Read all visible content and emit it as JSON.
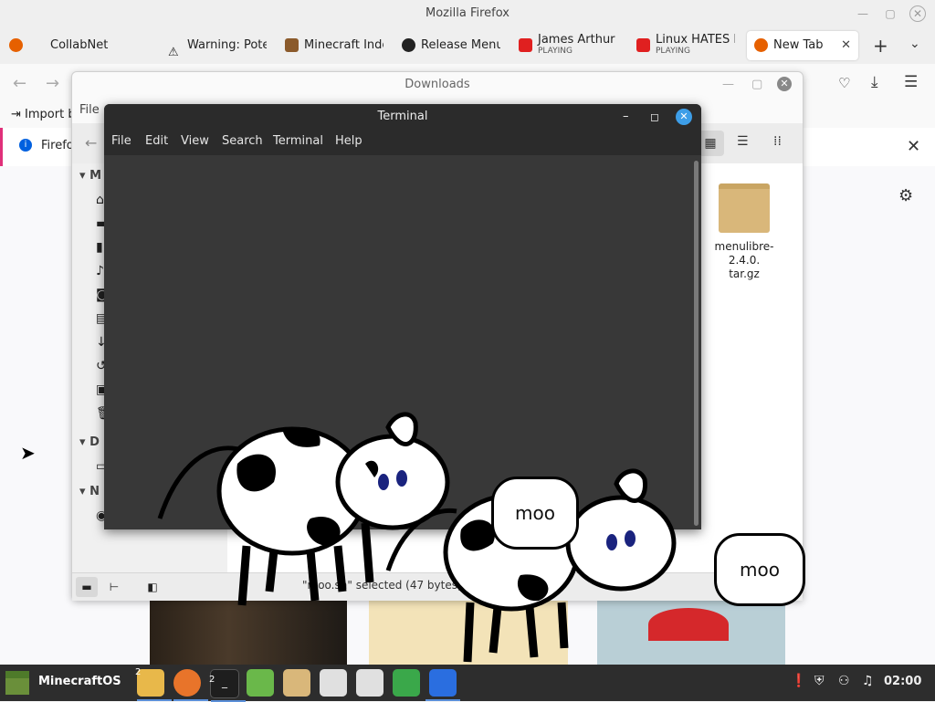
{
  "firefox": {
    "window_title": "Mozilla Firefox",
    "tabs": [
      {
        "label": "CollabNet",
        "icon": "firefox-icon"
      },
      {
        "label": "Warning: Pote",
        "icon": "warning-icon"
      },
      {
        "label": "Minecraft Inde",
        "icon": "minecraft-icon"
      },
      {
        "label": "Release Menu",
        "icon": "github-icon"
      },
      {
        "label": "James Arthur",
        "sub": "PLAYING",
        "icon": "youtube-icon"
      },
      {
        "label": "Linux HATES M",
        "sub": "PLAYING",
        "icon": "youtube-icon"
      },
      {
        "label": "New Tab",
        "icon": "firefox-icon"
      }
    ],
    "bookmark_import": "Import b",
    "notice_text": "Firefo"
  },
  "downloads": {
    "title": "Downloads",
    "menu_file": "File",
    "sidebar_headers": [
      "M",
      "D",
      "N"
    ],
    "file_name": "menulibre-2.4.0.tar.gz",
    "file_name_line1": "menulibre-2.4.0.",
    "file_name_line2": "tar.gz",
    "status_text": "\"moo.sh\" selected (47 bytes),"
  },
  "terminal": {
    "title": "Terminal",
    "menu": [
      "File",
      "Edit",
      "View",
      "Search",
      "Terminal",
      "Help"
    ]
  },
  "cows": {
    "bubble1": "moo",
    "bubble2": "moo"
  },
  "taskbar": {
    "start_label": "MinecraftOS",
    "clock": "02:00",
    "files_badge": "2",
    "terminal_badge": "2"
  },
  "colors": {
    "terminal_bg": "#383838",
    "taskbar_bg": "#2d2d2d",
    "folder_tan": "#d9b77a",
    "mint_green": "#6ab84a"
  }
}
